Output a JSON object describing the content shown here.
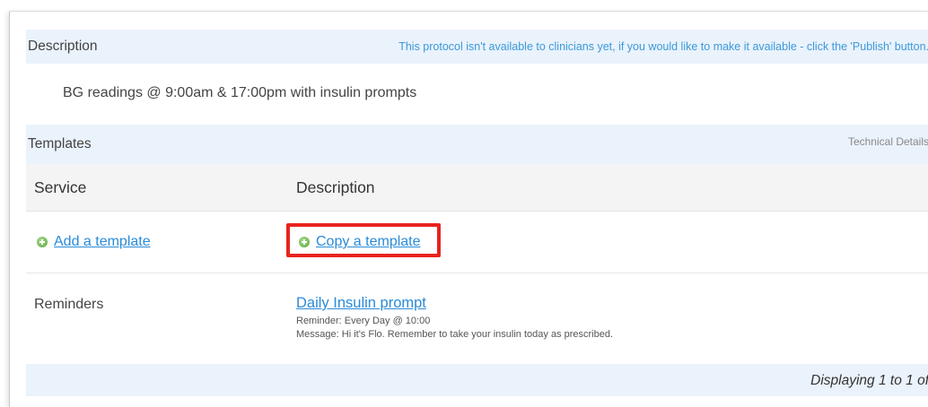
{
  "description_section": {
    "title": "Description",
    "notice": "This protocol isn't available to clinicians yet, if you would like to make it available - click the 'Publish' button.",
    "text": "BG readings @ 9:00am & 17:00pm with insulin prompts"
  },
  "templates_section": {
    "title": "Templates",
    "technical_details_label": "Technical Details",
    "columns": [
      "Service",
      "Description"
    ],
    "add_template_label": "Add a template",
    "copy_template_label": "Copy a template",
    "rows": [
      {
        "service": "Reminders",
        "template_name": "Daily Insulin prompt",
        "reminder": "Reminder: Every Day @ 10:00",
        "message": "Message: Hi it's Flo. Remember to take your insulin today as prescribed."
      }
    ],
    "pagination": "Displaying 1 to 1 of"
  },
  "icons": {
    "add": "plus-circle-icon",
    "copy": "plus-circle-icon"
  },
  "colors": {
    "link": "#2a8bd8",
    "notice": "#3b9ad9",
    "section_background": "#eaf2fc",
    "highlight": "#e8231e",
    "icon_green": "#5aa83c"
  }
}
